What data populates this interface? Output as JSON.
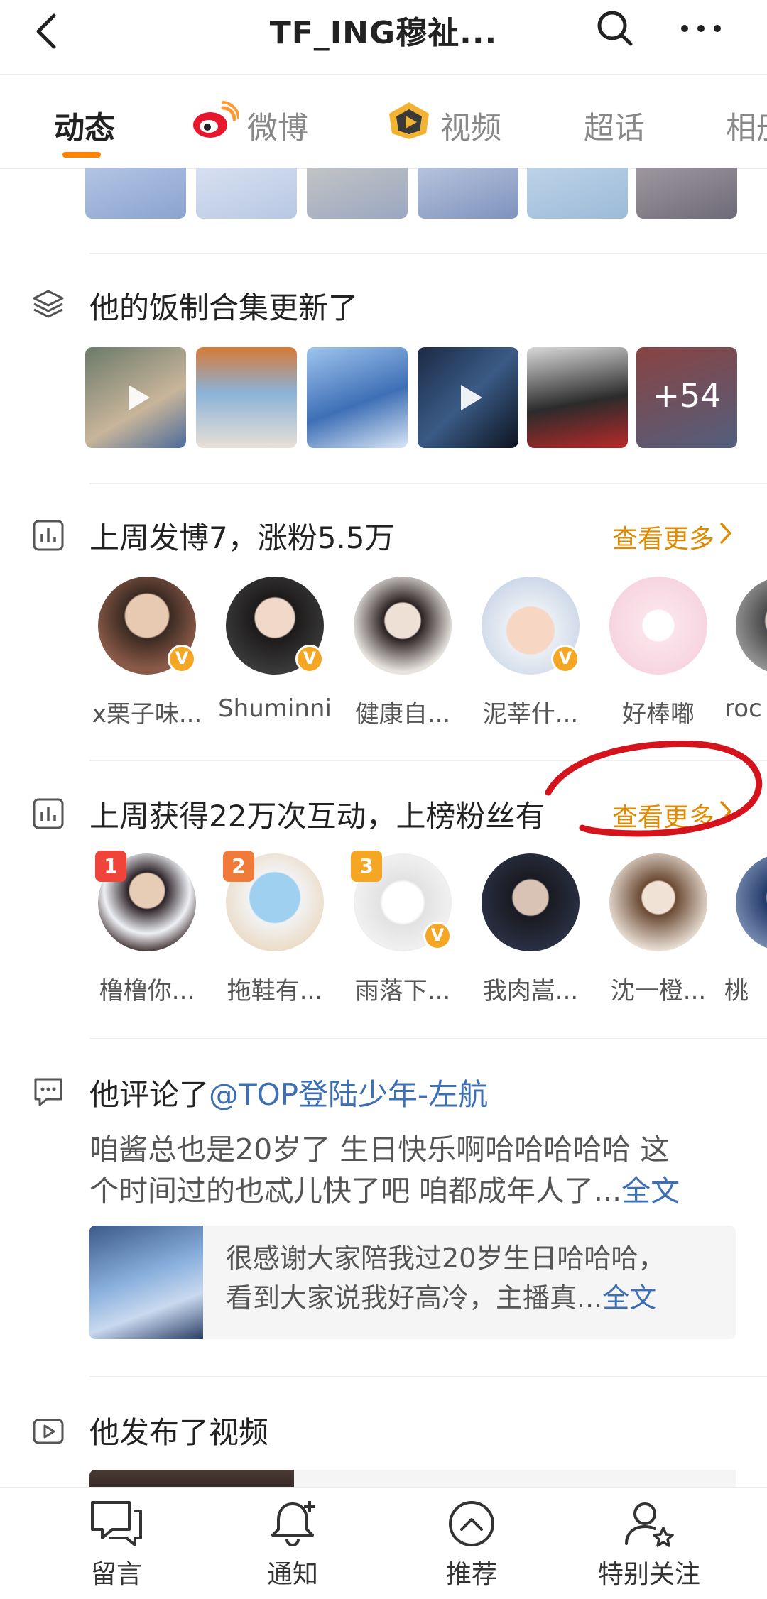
{
  "header": {
    "title": "TF_ING穆祉..."
  },
  "tabs": [
    {
      "label": "动态"
    },
    {
      "label": "微博"
    },
    {
      "label": "视频"
    },
    {
      "label": "超话"
    },
    {
      "label": "相册"
    }
  ],
  "fan_collection": {
    "title": "他的饭制合集更新了",
    "more_count": "+54"
  },
  "weekly_posts": {
    "title": "上周发博7，涨粉5.5万",
    "see_more": "查看更多",
    "users": [
      {
        "name": "x栗子味..."
      },
      {
        "name": "Shuminni"
      },
      {
        "name": "健康自..."
      },
      {
        "name": "泥莘什..."
      },
      {
        "name": "好棒嘟"
      },
      {
        "name": "roc"
      }
    ]
  },
  "interactions": {
    "title": "上周获得22万次互动，上榜粉丝有",
    "see_more": "查看更多",
    "users": [
      {
        "name": "橹橹你...",
        "rank": "1"
      },
      {
        "name": "拖鞋有...",
        "rank": "2"
      },
      {
        "name": "雨落下...",
        "rank": "3"
      },
      {
        "name": "我肉嵩..."
      },
      {
        "name": "沈一橙..."
      },
      {
        "name": "桃"
      }
    ]
  },
  "comment": {
    "title_prefix": "他评论了",
    "mention": "@TOP登陆少年-左航",
    "text_line1": "咱酱总也是20岁了  生日快乐啊哈哈哈哈哈 这",
    "text_line2": "个时间过的也忒儿快了吧 咱都成年人了...",
    "full_text": "全文",
    "quote_line1": "很感谢大家陪我过20岁生日哈哈哈，",
    "quote_line2": "看到大家说我好高冷，主播真...",
    "quote_full": "全文"
  },
  "video_section": {
    "title": "他发布了视频"
  },
  "bottom_nav": [
    {
      "label": "留言"
    },
    {
      "label": "通知"
    },
    {
      "label": "推荐"
    },
    {
      "label": "特别关注"
    }
  ],
  "colors": {
    "accent": "#ff8200",
    "link": "#3d6fb5",
    "badge": "#f5a623"
  }
}
